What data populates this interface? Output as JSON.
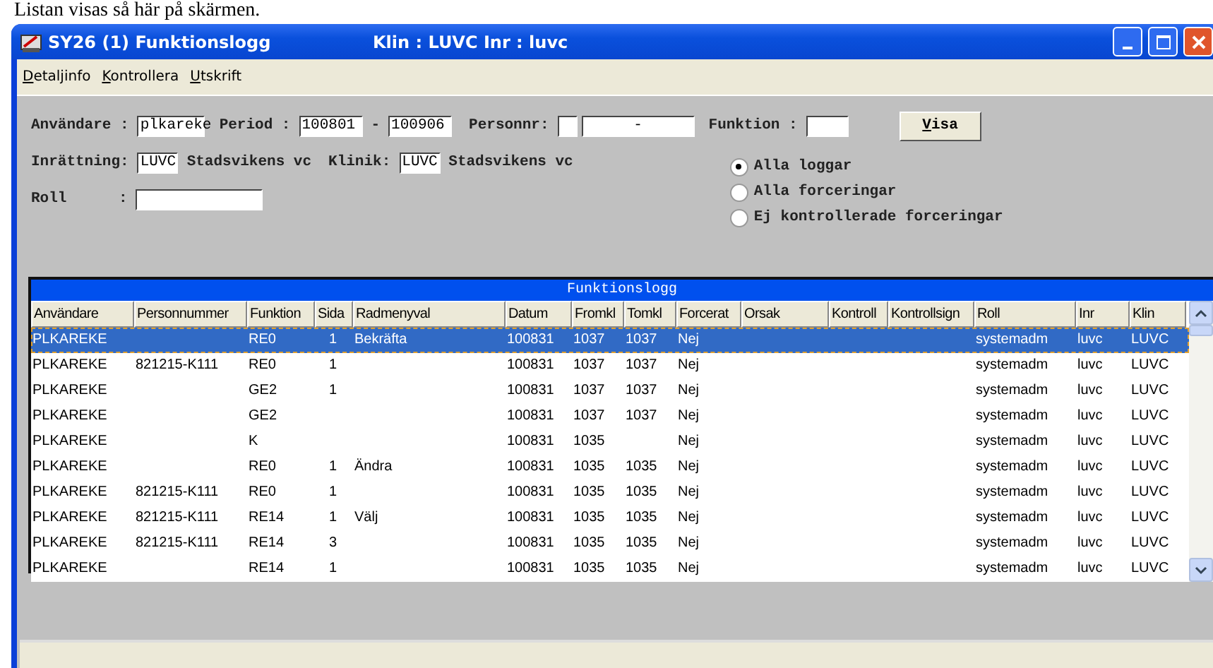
{
  "caption": "Listan visas så här på skärmen.",
  "window": {
    "title": "SY26 (1) Funktionslogg",
    "context": "Klin : LUVC  Inr : luvc"
  },
  "menu": [
    "Detaljinfo",
    "Kontrollera",
    "Utskrift"
  ],
  "form": {
    "anvandare": {
      "label": "Användare :",
      "value": "plkareke"
    },
    "period": {
      "label": "Period  :",
      "from": "100801",
      "separator": "-",
      "to": "100906"
    },
    "personnr": {
      "label": "Personnr:",
      "dash": "-"
    },
    "funktion": {
      "label": "Funktion :"
    },
    "visa": "Visa",
    "inrattning": {
      "label": "Inrättning:",
      "code": "LUVC",
      "name": "Stadsvikens vc"
    },
    "klinik": {
      "label": "Klinik:",
      "code": "LUVC",
      "name": "Stadsvikens vc"
    },
    "roll": {
      "label": "Roll",
      "colon": ":"
    },
    "filters": [
      {
        "label": "Alla loggar",
        "selected": true
      },
      {
        "label": "Alla forceringar",
        "selected": false
      },
      {
        "label": "Ej kontrollerade forceringar",
        "selected": false
      }
    ]
  },
  "table": {
    "title": "Funktionslogg",
    "columns": [
      "Användare",
      "Personnummer",
      "Funktion",
      "Sida",
      "Radmenyval",
      "Datum",
      "Fromkl",
      "Tomkl",
      "Forcerat",
      "Orsak",
      "Kontroll",
      "Kontrollsign",
      "Roll",
      "Inr",
      "Klin"
    ],
    "rows": [
      {
        "selected": true,
        "cells": [
          "PLKAREKE",
          "",
          "RE0",
          "1",
          "Bekräfta",
          "100831",
          "1037",
          "1037",
          "Nej",
          "",
          "",
          "",
          "systemadm",
          "luvc",
          "LUVC"
        ]
      },
      {
        "selected": false,
        "cells": [
          "PLKAREKE",
          "821215-K111",
          "RE0",
          "1",
          "",
          "100831",
          "1037",
          "1037",
          "Nej",
          "",
          "",
          "",
          "systemadm",
          "luvc",
          "LUVC"
        ]
      },
      {
        "selected": false,
        "cells": [
          "PLKAREKE",
          "",
          "GE2",
          "1",
          "",
          "100831",
          "1037",
          "1037",
          "Nej",
          "",
          "",
          "",
          "systemadm",
          "luvc",
          "LUVC"
        ]
      },
      {
        "selected": false,
        "cells": [
          "PLKAREKE",
          "",
          "GE2",
          "",
          "",
          "100831",
          "1037",
          "1037",
          "Nej",
          "",
          "",
          "",
          "systemadm",
          "luvc",
          "LUVC"
        ]
      },
      {
        "selected": false,
        "cells": [
          "PLKAREKE",
          "",
          "K",
          "",
          "",
          "100831",
          "1035",
          "",
          "Nej",
          "",
          "",
          "",
          "systemadm",
          "luvc",
          "LUVC"
        ]
      },
      {
        "selected": false,
        "cells": [
          "PLKAREKE",
          "",
          "RE0",
          "1",
          "Ändra",
          "100831",
          "1035",
          "1035",
          "Nej",
          "",
          "",
          "",
          "systemadm",
          "luvc",
          "LUVC"
        ]
      },
      {
        "selected": false,
        "cells": [
          "PLKAREKE",
          "821215-K111",
          "RE0",
          "1",
          "",
          "100831",
          "1035",
          "1035",
          "Nej",
          "",
          "",
          "",
          "systemadm",
          "luvc",
          "LUVC"
        ]
      },
      {
        "selected": false,
        "cells": [
          "PLKAREKE",
          "821215-K111",
          "RE14",
          "1",
          "Välj",
          "100831",
          "1035",
          "1035",
          "Nej",
          "",
          "",
          "",
          "systemadm",
          "luvc",
          "LUVC"
        ]
      },
      {
        "selected": false,
        "cells": [
          "PLKAREKE",
          "821215-K111",
          "RE14",
          "3",
          "",
          "100831",
          "1035",
          "1035",
          "Nej",
          "",
          "",
          "",
          "systemadm",
          "luvc",
          "LUVC"
        ]
      },
      {
        "selected": false,
        "cells": [
          "PLKAREKE",
          "",
          "RE14",
          "1",
          "",
          "100831",
          "1035",
          "1035",
          "Nej",
          "",
          "",
          "",
          "systemadm",
          "luvc",
          "LUVC"
        ]
      }
    ]
  }
}
